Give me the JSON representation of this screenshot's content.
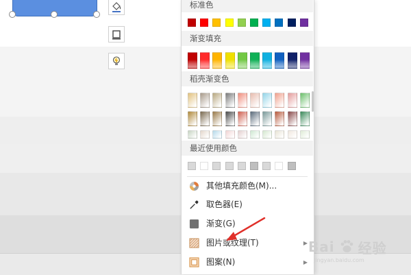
{
  "menu": {
    "sections": {
      "standard": "标准色",
      "gradient_fill": "渐变填充",
      "docer_gradient": "稻壳渐变色",
      "recent": "最近使用颜色"
    },
    "items": {
      "more_colors": "其他填充颜色(M)...",
      "eyedropper": "取色器(E)",
      "gradient": "渐变(G)",
      "picture_texture": "图片或纹理(T)",
      "pattern": "图案(N)"
    },
    "standard_colors": [
      "#c00000",
      "#ff0000",
      "#ffc000",
      "#ffff00",
      "#92d050",
      "#00b050",
      "#00b0f0",
      "#0070c0",
      "#002060",
      "#7030a0"
    ],
    "gradient_colors": [
      "#c00000",
      "#ff2a2a",
      "#ffb400",
      "#f0e000",
      "#72c844",
      "#10b056",
      "#10b0e0",
      "#1060c0",
      "#102068",
      "#7030a0"
    ],
    "docer_rows": [
      [
        "#e2c27e",
        "#a89a8a",
        "#b8a880",
        "#7a7a7a",
        "#f08d7c",
        "#e7bcae",
        "#93d5e8",
        "#f0a08c",
        "#e39b9b",
        "#6abf6a"
      ],
      [
        "#b08a3c",
        "#7a6a50",
        "#9a7a48",
        "#4a4a4a",
        "#d06050",
        "#5a6a7a",
        "#7a9a9a",
        "#b85a3c",
        "#8a4a4a",
        "#3a8a5a"
      ],
      [
        "#c8d6c4",
        "#e4d8cc",
        "#b6daea",
        "#f2d6d6",
        "#e4d0d0",
        "#cfe8d3",
        "#d6e8d0",
        "#e8e4d6",
        "#f0e8e0",
        "#e0ecd8"
      ]
    ],
    "recent_colors": [
      "#d9d9d9",
      "#ffffff",
      "#d9d9d9",
      "#d9d9d9",
      "#d9d9d9",
      "#bfbfbf",
      "#d9d9d9",
      "#ffffff",
      "#bfbfbf"
    ]
  },
  "watermark": {
    "brand": "Bai",
    "brand2": "经验",
    "sub": "jingyan.baidu.com"
  },
  "accent": "#e0302a"
}
